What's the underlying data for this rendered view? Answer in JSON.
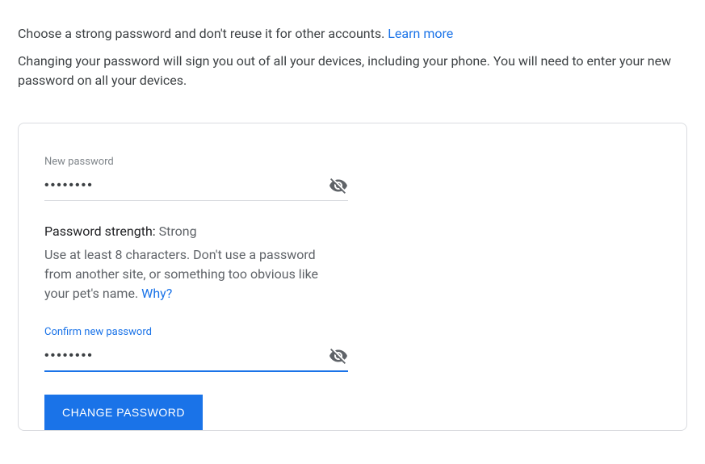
{
  "intro": {
    "text1": "Choose a strong password and don't reuse it for other accounts. ",
    "learn_more": "Learn more",
    "text2": "Changing your password will sign you out of all your devices, including your phone. You will need to enter your new password on all your devices."
  },
  "form": {
    "new_password": {
      "label": "New password",
      "value": "••••••••"
    },
    "strength": {
      "label": "Password strength: ",
      "value": "Strong"
    },
    "hint": {
      "text": "Use at least 8 characters. Don't use a password from another site, or something too obvious like your pet's name. ",
      "why": "Why?"
    },
    "confirm_password": {
      "label": "Confirm new password",
      "value": "••••••••"
    },
    "submit_label": "CHANGE PASSWORD"
  }
}
